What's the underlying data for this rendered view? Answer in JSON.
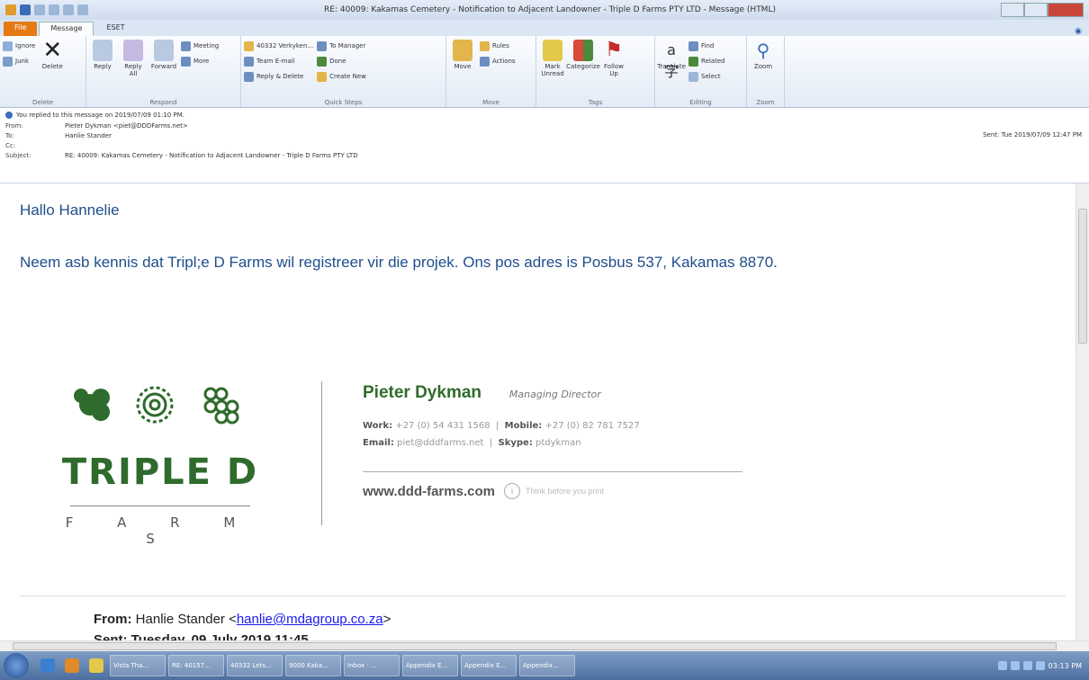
{
  "window": {
    "title": "RE: 40009: Kakamas Cemetery - Notification to Adjacent Landowner - Triple D Farms PTY LTD - Message (HTML)"
  },
  "tabs": [
    {
      "label": "File"
    },
    {
      "label": "Message"
    },
    {
      "label": "ESET"
    }
  ],
  "ribbon": {
    "delete": {
      "ignore": "Ignore",
      "junk": "Junk",
      "delete": "Delete",
      "label": "Delete"
    },
    "respond": {
      "reply": "Reply",
      "reply_all": "Reply All",
      "forward": "Forward",
      "meeting": "Meeting",
      "more": "More",
      "label": "Respond"
    },
    "quick_steps": {
      "items": [
        "40332 Verkyken...",
        "To Manager",
        "Team E-mail",
        "Done",
        "Reply & Delete",
        "Create New"
      ],
      "label": "Quick Steps"
    },
    "move": {
      "move": "Move",
      "rules": "Rules",
      "actions": "Actions",
      "label": "Move"
    },
    "tags": {
      "mark_unread": "Mark Unread",
      "categorize": "Categorize",
      "follow_up": "Follow Up",
      "label": "Tags"
    },
    "editing": {
      "translate": "Translate",
      "find": "Find",
      "related": "Related",
      "select": "Select",
      "label": "Editing"
    },
    "zoom": {
      "zoom": "Zoom",
      "label": "Zoom"
    }
  },
  "header": {
    "info": "You replied to this message on 2019/07/09 01:10 PM.",
    "from_label": "From:",
    "from": "Pieter Dykman <piet@DDDFarms.net>",
    "to_label": "To:",
    "to": "Hanlie Stander",
    "cc_label": "Cc:",
    "subject_label": "Subject:",
    "subject": "RE: 40009: Kakamas Cemetery - Notification to Adjacent Landowner - Triple D Farms PTY LTD",
    "sent": "Sent: Tue 2019/07/09 12:47 PM"
  },
  "body": {
    "greeting": "Hallo Hannelie",
    "paragraph": "Neem asb kennis dat Tripl;e D Farms wil registreer vir die projek.  Ons pos adres is Posbus 537, Kakamas 8870.",
    "logo": {
      "main": "TRIPLE D",
      "sub": "F A R M S"
    },
    "signature": {
      "name": "Pieter Dykman",
      "role": "Managing Director",
      "work_label": "Work:",
      "work": "+27 (0) 54 431 1568",
      "mobile_label": "Mobile:",
      "mobile": "+27 (0) 82 781 7527",
      "email_label": "Email:",
      "email": "piet@dddfarms.net",
      "skype_label": "Skype:",
      "skype": "ptdykman",
      "web": "www.ddd-farms.com",
      "think": "Think before you print"
    },
    "quoted": {
      "from_label": "From:",
      "from_name": "Hanlie Stander <",
      "from_email": "hanlie@mdagroup.co.za",
      "from_end": ">",
      "sent_cut": "Sent: Tuesday, 09 July 2019 11:45"
    }
  },
  "taskbar": {
    "items": [
      "Vista Tha...",
      "RE: 40157...",
      "40332 Lets...",
      "9000 Kaka...",
      "Inbox - ...",
      "Appendix E...",
      "Appendix E...",
      "Appendix..."
    ],
    "clock": "03:13 PM"
  },
  "colors": {
    "accent": "#1f4e8c",
    "brand_green": "#2f6b2c",
    "file_tab": "#e57a14"
  }
}
